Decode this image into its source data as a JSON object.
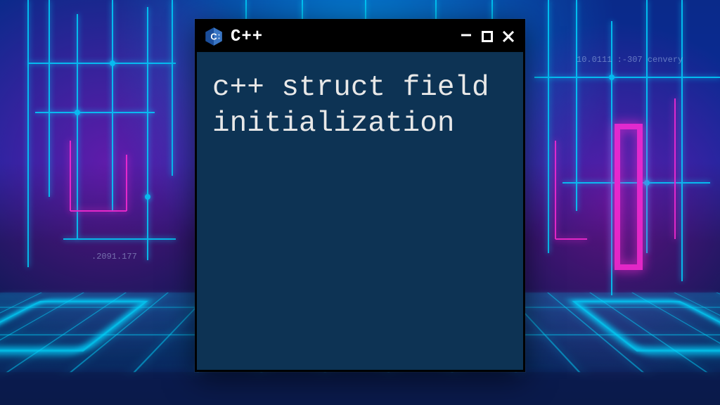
{
  "window": {
    "title": "C++",
    "content": "c++ struct field initialization"
  },
  "controls": {
    "minimize": "−",
    "maximize": "□",
    "close": "×"
  },
  "bg_labels": {
    "left_num": ".2091.177",
    "right_top": "10.0111 :-307  cenvery"
  }
}
